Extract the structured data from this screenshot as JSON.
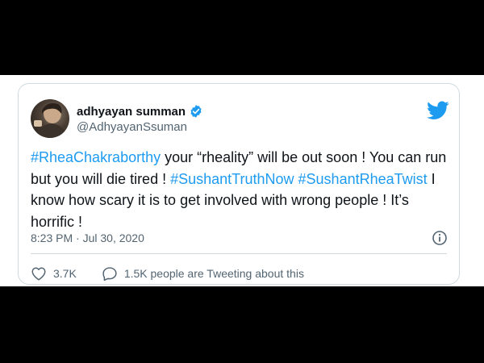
{
  "tweet": {
    "author_name": "adhyayan summan",
    "author_handle": "@AdhyayanSsuman",
    "text_segments": [
      {
        "text": "#RheaChakraborthy",
        "hashtag": true
      },
      {
        "text": " your “rheality” will be out soon ! You can run but you will die tired ! ",
        "hashtag": false
      },
      {
        "text": "#SushantTruthNow",
        "hashtag": true
      },
      {
        "text": " ",
        "hashtag": false
      },
      {
        "text": "#SushantRheaTwist",
        "hashtag": true
      },
      {
        "text": " I know how scary it is to get involved with wrong people ! It’s horrific !",
        "hashtag": false
      }
    ],
    "timestamp": "8:23 PM · Jul 30, 2020",
    "likes": "3.7K",
    "tweeting_about": "1.5K people are Tweeting about this"
  },
  "colors": {
    "hashtag": "#1d9bf0",
    "verified": "#1d9bf0",
    "twitter_logo": "#1d9bf0",
    "text": "#0f1419",
    "secondary": "#536471",
    "border": "#cfd9de"
  },
  "icons": {
    "verified": "verified-badge-icon",
    "logo": "twitter-bird-icon",
    "info": "info-icon",
    "like": "heart-icon",
    "reply": "speech-bubble-icon"
  }
}
